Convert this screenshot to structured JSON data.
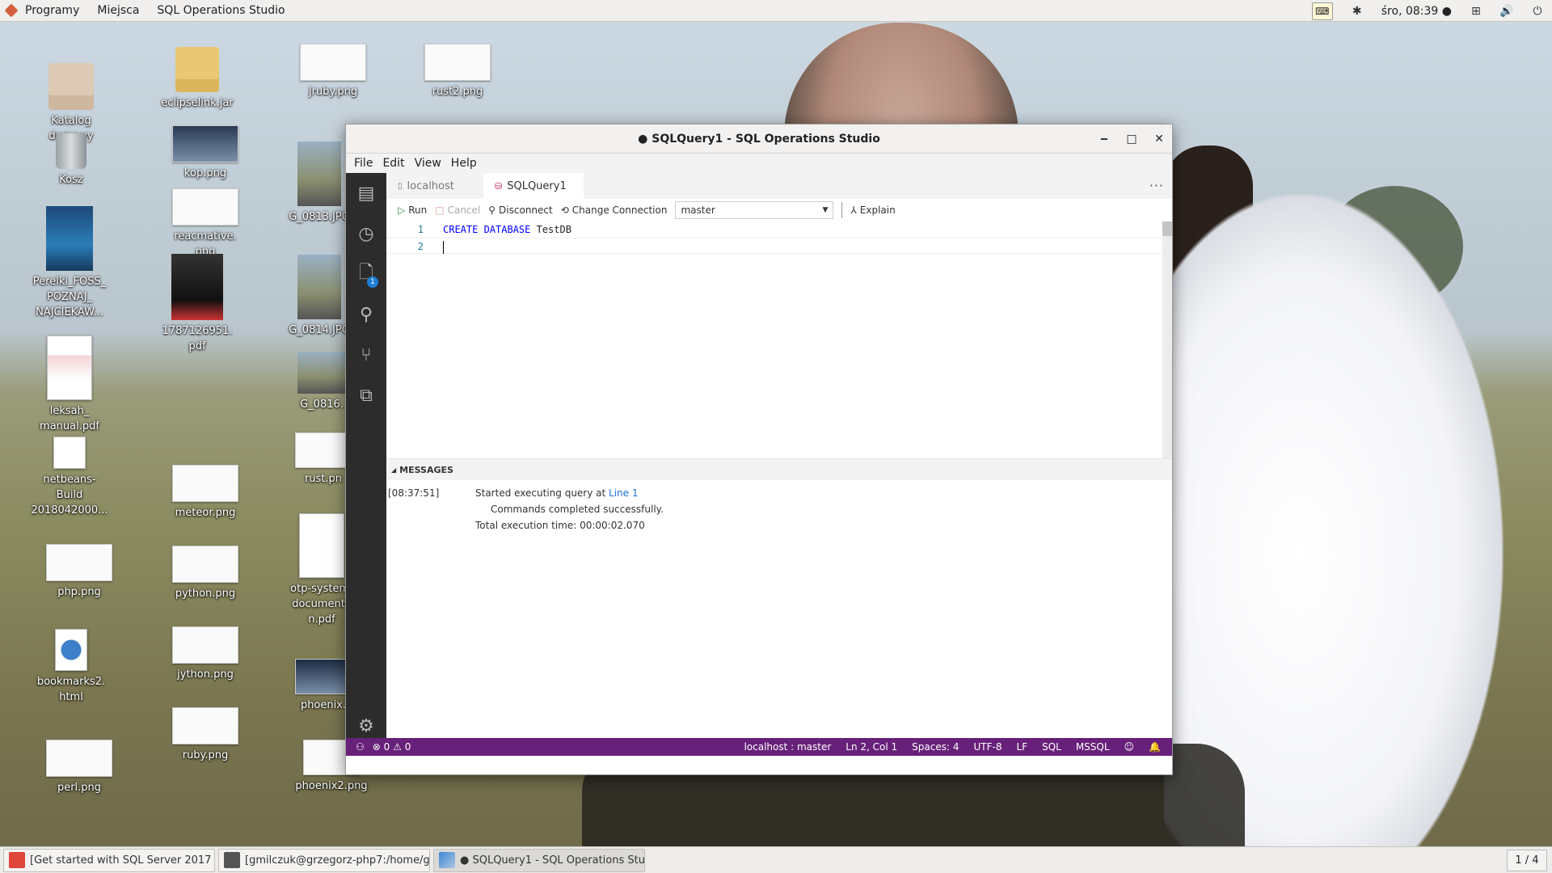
{
  "top_panel": {
    "menus": [
      "Programy",
      "Miejsca",
      "SQL Operations Studio"
    ],
    "clock": "śro, 08:39 ●",
    "tray_icons": [
      "keyboard-lock-icon",
      "accessibility-icon",
      "network-icon",
      "volume-icon",
      "power-icon"
    ]
  },
  "desktop_icons": [
    {
      "label": "Katalog domowy",
      "type": "home"
    },
    {
      "label": "Kosz",
      "type": "trash"
    },
    {
      "label": "Perelki_FOSS_ POZNAJ_ NAJCIEKAW...",
      "type": "book"
    },
    {
      "label": "leksah_ manual.pdf",
      "type": "doc"
    },
    {
      "label": "netbeans- Build 2018042000...",
      "type": "doc"
    },
    {
      "label": "php.png",
      "type": "thumb"
    },
    {
      "label": "bookmarks2. html",
      "type": "globe"
    },
    {
      "label": "perl.png",
      "type": "thumb"
    },
    {
      "label": "eclipselink.jar",
      "type": "folder"
    },
    {
      "label": "kop.png",
      "type": "thumb"
    },
    {
      "label": "reacmative. png",
      "type": "thumb"
    },
    {
      "label": "1787126951. pdf",
      "type": "book-dark"
    },
    {
      "label": "meteor.png",
      "type": "thumb"
    },
    {
      "label": "python.png",
      "type": "thumb"
    },
    {
      "label": "jython.png",
      "type": "thumb"
    },
    {
      "label": "ruby.png",
      "type": "thumb"
    },
    {
      "label": "jruby.png",
      "type": "thumb"
    },
    {
      "label": "G_0813.JPG",
      "type": "photo"
    },
    {
      "label": "G_0814.JPG",
      "type": "photo"
    },
    {
      "label": "G_0816.",
      "type": "photo"
    },
    {
      "label": "rust.pn",
      "type": "thumb"
    },
    {
      "label": "otp-system- documenta n.pdf",
      "type": "doc"
    },
    {
      "label": "phoenix.",
      "type": "thumb"
    },
    {
      "label": "phoenix2.png",
      "type": "thumb"
    },
    {
      "label": "rust2.png",
      "type": "thumb"
    }
  ],
  "window": {
    "title": "● SQLQuery1 - SQL Operations Studio",
    "controls": {
      "minimize": "‒",
      "maximize": "□",
      "close": "✕"
    },
    "menubar": [
      "File",
      "Edit",
      "View",
      "Help"
    ],
    "activity_bar": [
      {
        "icon": "servers-icon"
      },
      {
        "icon": "history-icon"
      },
      {
        "icon": "explorer-icon",
        "badge": "1"
      },
      {
        "icon": "search-icon"
      },
      {
        "icon": "source-control-icon"
      },
      {
        "icon": "extensions-icon"
      }
    ],
    "tabs": [
      {
        "label": "localhost",
        "active": false
      },
      {
        "label": "SQLQuery1",
        "active": true,
        "dirty": true
      }
    ],
    "toolbar": {
      "run": "Run",
      "cancel": "Cancel",
      "disconnect": "Disconnect",
      "change_connection": "Change Connection",
      "database": "master",
      "explain": "Explain"
    },
    "editor": {
      "lines": [
        {
          "number": "1",
          "keywords": "CREATE DATABASE",
          "rest": " TestDB"
        },
        {
          "number": "2",
          "keywords": "",
          "rest": ""
        }
      ]
    },
    "messages": {
      "header": "MESSAGES",
      "time": "[08:37:51]",
      "line1_prefix": "Started executing query at ",
      "line1_link": "Line 1",
      "line2": "Commands completed successfully.",
      "line3": "Total execution time: 00:00:02.070"
    },
    "statusbar": {
      "errors": "0",
      "warnings": "0",
      "connection": "localhost : master",
      "position": "Ln 2, Col 1",
      "spaces": "Spaces: 4",
      "encoding": "UTF-8",
      "eol": "LF",
      "language": "SQL",
      "provider": "MSSQL",
      "accent_color": "#68217a"
    }
  },
  "taskbar": {
    "tasks": [
      {
        "label": "[Get started with SQL Server 2017 ...",
        "active": false
      },
      {
        "label": "[gmilczuk@grzegorz-php7:/home/g...",
        "active": false
      },
      {
        "label": "● SQLQuery1 - SQL Operations Stu...",
        "active": true
      }
    ],
    "pager": "1 / 4"
  }
}
